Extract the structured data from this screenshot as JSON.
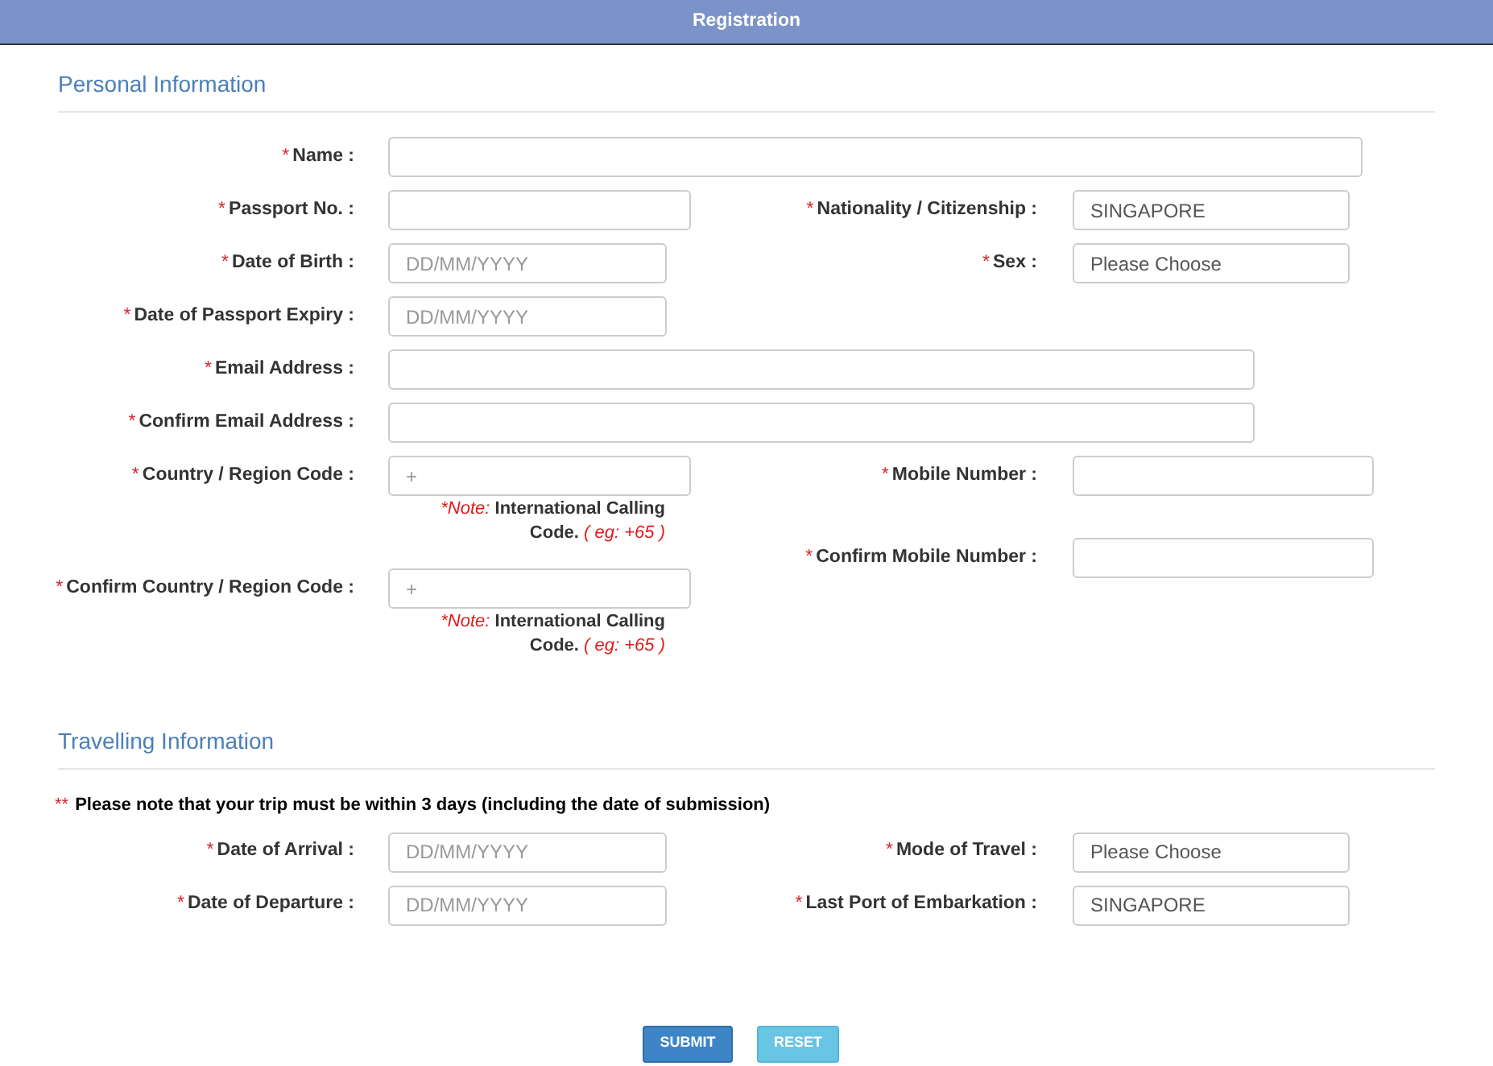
{
  "header": {
    "title": "Registration"
  },
  "personal": {
    "heading": "Personal Information",
    "rows": [
      {
        "left": {
          "mark": "*",
          "label": "Name :"
        }
      },
      {
        "left": {
          "mark": "*",
          "label": "Passport No. :"
        },
        "right": {
          "mark": "*",
          "label": "Nationality / Citizenship :",
          "value": "SINGAPORE"
        }
      },
      {
        "left": {
          "mark": "*",
          "label": "Date of Birth :",
          "placeholder": "DD/MM/YYYY"
        },
        "right": {
          "mark": "*",
          "label": "Sex :",
          "value": "Please Choose"
        }
      },
      {
        "left": {
          "mark": "*",
          "label": "Date of Passport Expiry :",
          "placeholder": "DD/MM/YYYY"
        }
      },
      {
        "left": {
          "mark": "*",
          "label": "Email Address :"
        }
      },
      {
        "left": {
          "mark": "*",
          "label": "Confirm Email Address :"
        }
      }
    ],
    "calling": [
      {
        "mark": "*",
        "label": "Country / Region Code :",
        "placeholder": "+",
        "note": {
          "prefix": "*Note:",
          "text": "International Calling Code.",
          "example": "( eg: +65 )"
        }
      },
      {
        "mark": "*",
        "label": "Confirm Country / Region Code :",
        "placeholder": "+",
        "note": {
          "prefix": "*Note:",
          "text": "International Calling Code.",
          "example": "( eg: +65 )"
        }
      }
    ],
    "mobile": [
      {
        "mark": "*",
        "label": "Mobile Number :"
      },
      {
        "mark": "*",
        "label": "Confirm Mobile Number :"
      }
    ]
  },
  "travelling": {
    "heading": "Travelling Information",
    "notice": {
      "mark": "**",
      "text": "Please note that your trip must be within 3 days (including the date of submission)"
    },
    "rows": [
      {
        "left": {
          "mark": "*",
          "label": "Date of Arrival :",
          "placeholder": "DD/MM/YYYY"
        },
        "right": {
          "mark": "*",
          "label": "Mode of Travel :",
          "value": "Please Choose"
        }
      },
      {
        "left": {
          "mark": "*",
          "label": "Date of Departure :",
          "placeholder": "DD/MM/YYYY"
        },
        "right": {
          "mark": "*",
          "label": "Last Port of Embarkation :",
          "value": "SINGAPORE"
        }
      }
    ]
  },
  "buttons": [
    {
      "label": "SUBMIT",
      "kind": "primary"
    },
    {
      "label": "RESET",
      "kind": "secondary"
    }
  ]
}
